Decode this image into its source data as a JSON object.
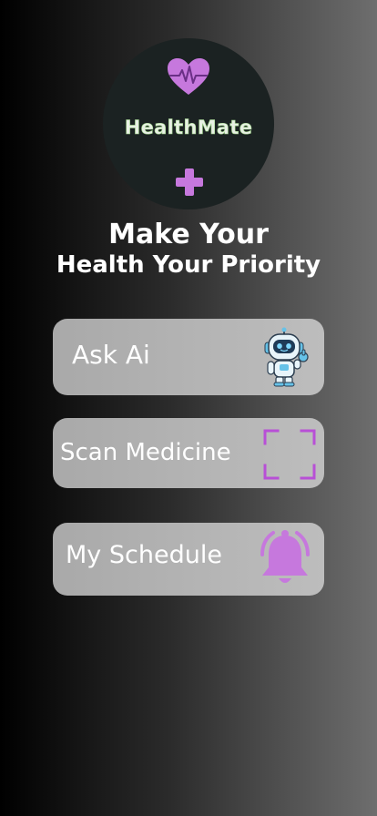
{
  "app": {
    "logo_text": "HealthMate",
    "logo_icons": [
      "heartbeat-icon",
      "medical-plus-icon"
    ]
  },
  "headline": {
    "line1": "Make Your",
    "line2": "Health Your Priority"
  },
  "actions": [
    {
      "label": "Ask Ai",
      "icon": "robot-icon"
    },
    {
      "label": "Scan Medicine",
      "icon": "scan-frame-icon"
    },
    {
      "label": "My Schedule",
      "icon": "bell-icon"
    }
  ],
  "colors": {
    "accent": "#c678dd",
    "card_background": "#b5b5b5",
    "logo_circle": "#1b2222",
    "text": "#ffffff"
  }
}
